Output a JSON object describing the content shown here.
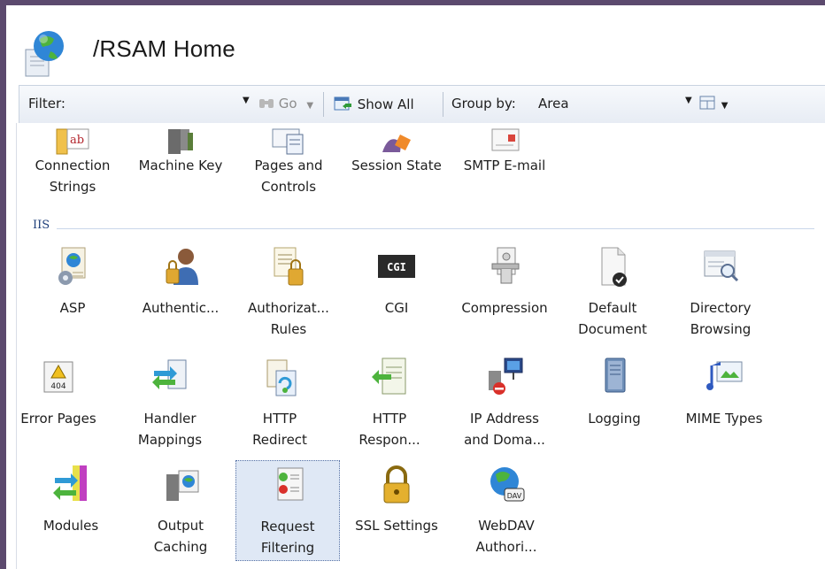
{
  "header": {
    "title": "/RSAM Home"
  },
  "toolbar": {
    "filter_label": "Filter:",
    "filter_value": "",
    "go_label": "Go",
    "show_all_label": "Show All",
    "group_by_label": "Group by:",
    "group_by_value": "Area"
  },
  "top_row": [
    {
      "label": "Connection",
      "label2": "Strings"
    },
    {
      "label": "Machine Key",
      "label2": ""
    },
    {
      "label": "Pages and",
      "label2": "Controls"
    },
    {
      "label": "Session State",
      "label2": ""
    },
    {
      "label": "SMTP E-mail",
      "label2": ""
    }
  ],
  "iis_group": {
    "title": "IIS",
    "row1": [
      {
        "label": "ASP",
        "label2": ""
      },
      {
        "label": "Authentic...",
        "label2": ""
      },
      {
        "label": "Authorizat...",
        "label2": "Rules"
      },
      {
        "label": "CGI",
        "label2": ""
      },
      {
        "label": "Compression",
        "label2": ""
      },
      {
        "label": "Default",
        "label2": "Document"
      },
      {
        "label": "Directory",
        "label2": "Browsing"
      }
    ],
    "row2": [
      {
        "label": "Error Pages",
        "label2": ""
      },
      {
        "label": "Handler",
        "label2": "Mappings"
      },
      {
        "label": "HTTP",
        "label2": "Redirect"
      },
      {
        "label": "HTTP",
        "label2": "Respon..."
      },
      {
        "label": "IP Address",
        "label2": "and Doma..."
      },
      {
        "label": "Logging",
        "label2": ""
      },
      {
        "label": "MIME Types",
        "label2": ""
      }
    ],
    "row3": [
      {
        "label": "Modules",
        "label2": ""
      },
      {
        "label": "Output",
        "label2": "Caching"
      },
      {
        "label": "Request",
        "label2": "Filtering"
      },
      {
        "label": "SSL Settings",
        "label2": ""
      },
      {
        "label": "WebDAV",
        "label2": "Authori..."
      }
    ]
  },
  "colors": {
    "accent": "#1f3f7a",
    "selection": "#dfe8f5",
    "frame": "#5c4a6e"
  },
  "cgi_icon_text": "CGI",
  "error_icon_text": "404",
  "webdav_icon_text": "DAV",
  "conn_icon_text": "ab"
}
